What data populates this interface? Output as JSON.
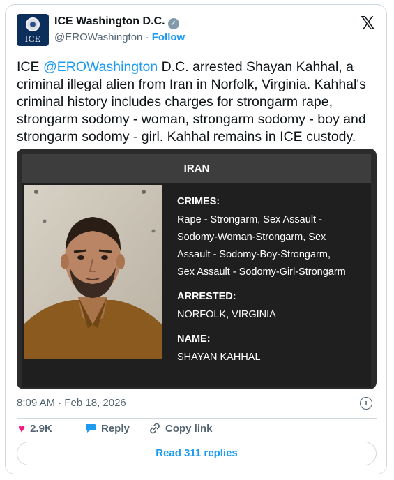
{
  "account": {
    "name": "ICE Washington D.C.",
    "handle": "@EROWashington",
    "separator": "·",
    "follow_label": "Follow",
    "avatar_text": "ICE"
  },
  "icons": {
    "verified": "verified-badge-icon",
    "x_logo": "x-logo-icon",
    "info": "info-icon",
    "like": "heart-icon",
    "reply": "speech-bubble-icon",
    "copy": "link-icon"
  },
  "tweet": {
    "prefix": "ICE ",
    "mention": "@EROWashington",
    "body": " D.C. arrested Shayan Kahhal, a criminal illegal alien from Iran in Norfolk, Virginia. Kahhal's criminal history includes charges for strongarm rape, strongarm sodomy - woman, strongarm sodomy - boy and strongarm sodomy - girl. Kahhal remains in ICE custody."
  },
  "media": {
    "country": "IRAN",
    "crimes_label": "CRIMES:",
    "crimes_lines": [
      "Rape - Strongarm, Sex Assault -",
      "Sodomy-Woman-Strongarm, Sex",
      "Assault - Sodomy-Boy-Strongarm,",
      "Sex Assault - Sodomy-Girl-Strongarm"
    ],
    "arrested_label": "ARRESTED:",
    "arrested_value": "NORFOLK, VIRGINIA",
    "name_label": "NAME:",
    "name_value": "SHAYAN KAHHAL"
  },
  "meta": {
    "timestamp": "8:09 AM · Feb 18, 2026"
  },
  "actions": {
    "likes": "2.9K",
    "reply_label": "Reply",
    "copy_label": "Copy link",
    "read_replies": "Read 311 replies"
  },
  "colors": {
    "accent": "#1d9bf0",
    "like": "#f91880",
    "muted": "#536471"
  }
}
